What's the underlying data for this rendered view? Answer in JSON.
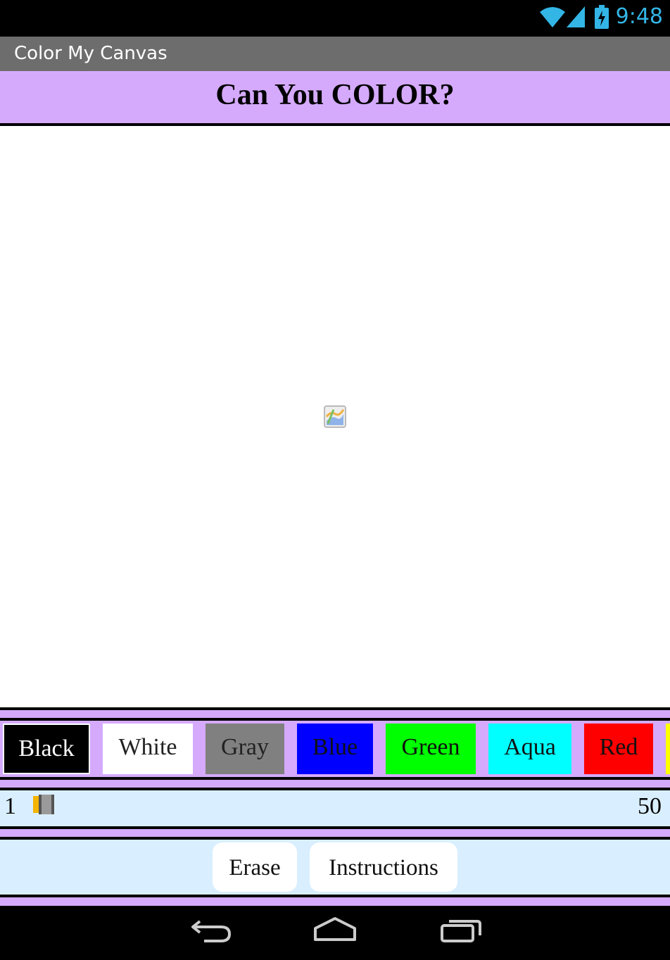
{
  "status_bar": {
    "time": "9:48",
    "icons": [
      "wifi-icon",
      "signal-icon",
      "battery-charging-icon"
    ],
    "accent_color": "#33b5e5"
  },
  "app": {
    "title": "Color My Canvas"
  },
  "header": {
    "heading": "Can You COLOR?",
    "background": "#d5aafd"
  },
  "canvas": {
    "placeholder_icon": "broken-image-icon",
    "background": "#ffffff"
  },
  "palette": {
    "colors": [
      {
        "label": "Black",
        "color": "#000000"
      },
      {
        "label": "White",
        "color": "#ffffff"
      },
      {
        "label": "Gray",
        "color": "#808080"
      },
      {
        "label": "Blue",
        "color": "#0000ff"
      },
      {
        "label": "Green",
        "color": "#00ff00"
      },
      {
        "label": "Aqua",
        "color": "#00ffff"
      },
      {
        "label": "Red",
        "color": "#ff0000"
      },
      {
        "label": "",
        "color": "#ffff00"
      }
    ]
  },
  "brush_size": {
    "min": "1",
    "max": "50",
    "value": 1
  },
  "buttons": {
    "erase": "Erase",
    "instructions": "Instructions"
  },
  "nav_bar": {
    "icons": [
      "back-icon",
      "home-icon",
      "recents-icon"
    ]
  }
}
